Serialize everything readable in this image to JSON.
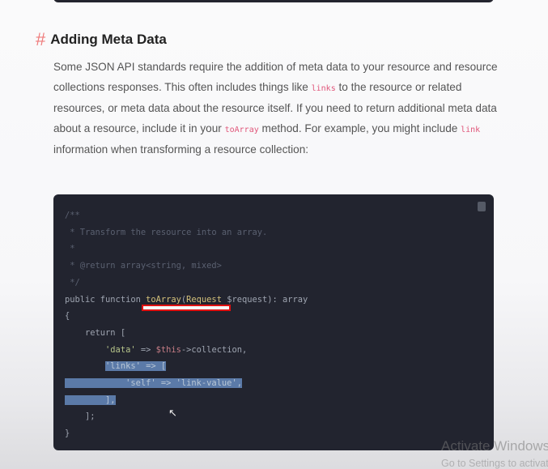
{
  "section": {
    "anchor": "#",
    "title": "Adding Meta Data",
    "paragraph": {
      "p1": "Some JSON API standards require the addition of meta data to your resource and resource collections responses. This often includes things like ",
      "c1": "links",
      "p2": " to the resource or related resources, or meta data about the resource itself. If you need to return additional meta data about a resource, include it in your ",
      "c2": "toArray",
      "p3": " method. For example, you might include ",
      "c3": "link",
      "p4": " information when transforming a resource collection:"
    }
  },
  "code": {
    "lines": [
      "/**",
      " * Transform the resource into an array.",
      " *",
      " * @return array<string, mixed>",
      " */",
      "public function toArray(Request $request): array",
      "{",
      "    return [",
      "        'data' => $this->collection,",
      "        'links' => [",
      "            'self' => 'link-value',",
      "        ],",
      "    ];",
      "}"
    ]
  },
  "watermark": {
    "line1": "Activate Windows",
    "line2": "Go to Settings to activate Windows."
  }
}
